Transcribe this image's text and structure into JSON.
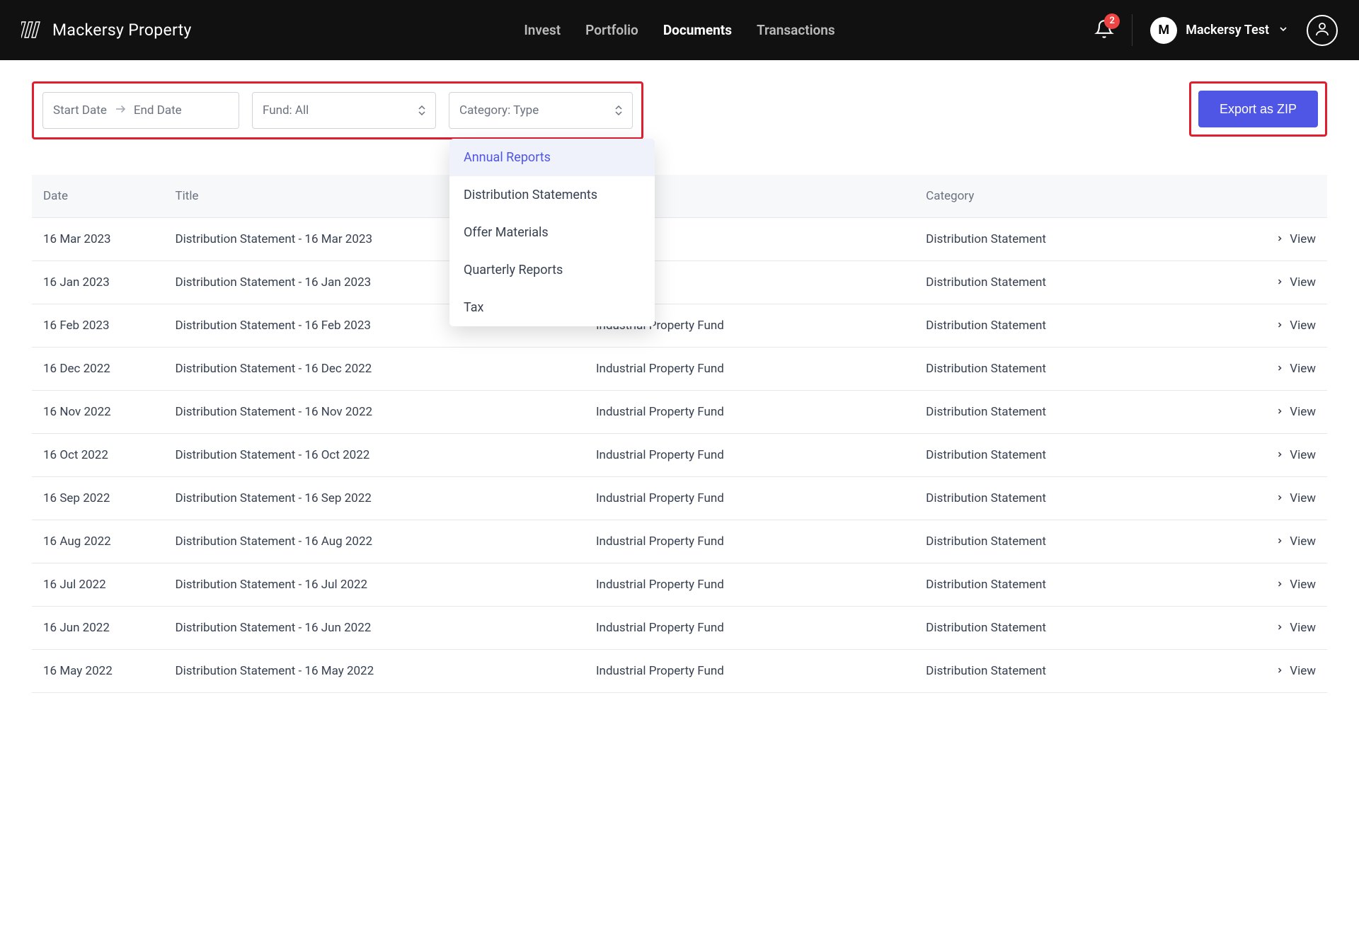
{
  "header": {
    "brand": "Mackersy Property",
    "nav": {
      "invest": "Invest",
      "portfolio": "Portfolio",
      "documents": "Documents",
      "transactions": "Transactions"
    },
    "notification_count": "2",
    "avatar_initial": "M",
    "user_name": "Mackersy Test"
  },
  "filters": {
    "start_date_placeholder": "Start Date",
    "end_date_placeholder": "End Date",
    "fund_label": "Fund: All",
    "category_label": "Category: Type",
    "category_options": {
      "annual": "Annual Reports",
      "distribution": "Distribution Statements",
      "offer": "Offer Materials",
      "quarterly": "Quarterly Reports",
      "tax": "Tax"
    },
    "export_label": "Export as ZIP"
  },
  "table": {
    "headers": {
      "date": "Date",
      "title": "Title",
      "fund": "",
      "category": "Category",
      "action": ""
    },
    "view_label": "View",
    "rows": [
      {
        "date": "16 Mar 2023",
        "title": "Distribution Statement - 16 Mar 2023",
        "fund": "",
        "category": "Distribution Statement"
      },
      {
        "date": "16 Jan 2023",
        "title": "Distribution Statement - 16 Jan 2023",
        "fund": "",
        "category": "Distribution Statement"
      },
      {
        "date": "16 Feb 2023",
        "title": "Distribution Statement - 16 Feb 2023",
        "fund": "Industrial Property Fund",
        "category": "Distribution Statement"
      },
      {
        "date": "16 Dec 2022",
        "title": "Distribution Statement - 16 Dec 2022",
        "fund": "Industrial Property Fund",
        "category": "Distribution Statement"
      },
      {
        "date": "16 Nov 2022",
        "title": "Distribution Statement - 16 Nov 2022",
        "fund": "Industrial Property Fund",
        "category": "Distribution Statement"
      },
      {
        "date": "16 Oct 2022",
        "title": "Distribution Statement - 16 Oct 2022",
        "fund": "Industrial Property Fund",
        "category": "Distribution Statement"
      },
      {
        "date": "16 Sep 2022",
        "title": "Distribution Statement - 16 Sep 2022",
        "fund": "Industrial Property Fund",
        "category": "Distribution Statement"
      },
      {
        "date": "16 Aug 2022",
        "title": "Distribution Statement - 16 Aug 2022",
        "fund": "Industrial Property Fund",
        "category": "Distribution Statement"
      },
      {
        "date": "16 Jul 2022",
        "title": "Distribution Statement - 16 Jul 2022",
        "fund": "Industrial Property Fund",
        "category": "Distribution Statement"
      },
      {
        "date": "16 Jun 2022",
        "title": "Distribution Statement - 16 Jun 2022",
        "fund": "Industrial Property Fund",
        "category": "Distribution Statement"
      },
      {
        "date": "16 May 2022",
        "title": "Distribution Statement - 16 May 2022",
        "fund": "Industrial Property Fund",
        "category": "Distribution Statement"
      }
    ]
  }
}
